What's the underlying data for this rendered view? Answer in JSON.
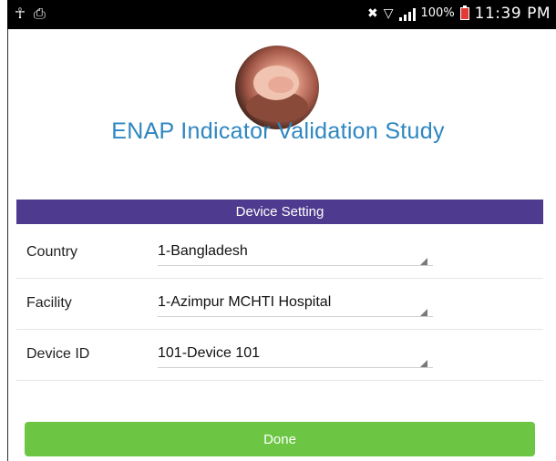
{
  "status_bar": {
    "left_icons": [
      "usb-icon",
      "sim-card-icon"
    ],
    "battery_percent": "100%",
    "time": "11:39 PM"
  },
  "app": {
    "title": "ENAP Indicator Validation Study"
  },
  "device_setting": {
    "header": "Device Setting",
    "fields": [
      {
        "label": "Country",
        "value": "1-Bangladesh"
      },
      {
        "label": "Facility",
        "value": "1-Azimpur MCHTI Hospital"
      },
      {
        "label": "Device ID",
        "value": "101-Device 101"
      }
    ]
  },
  "actions": {
    "done_label": "Done"
  },
  "colors": {
    "title": "#2e86c1",
    "header_bg": "#4e3a8e",
    "done_bg": "#6cc644"
  }
}
